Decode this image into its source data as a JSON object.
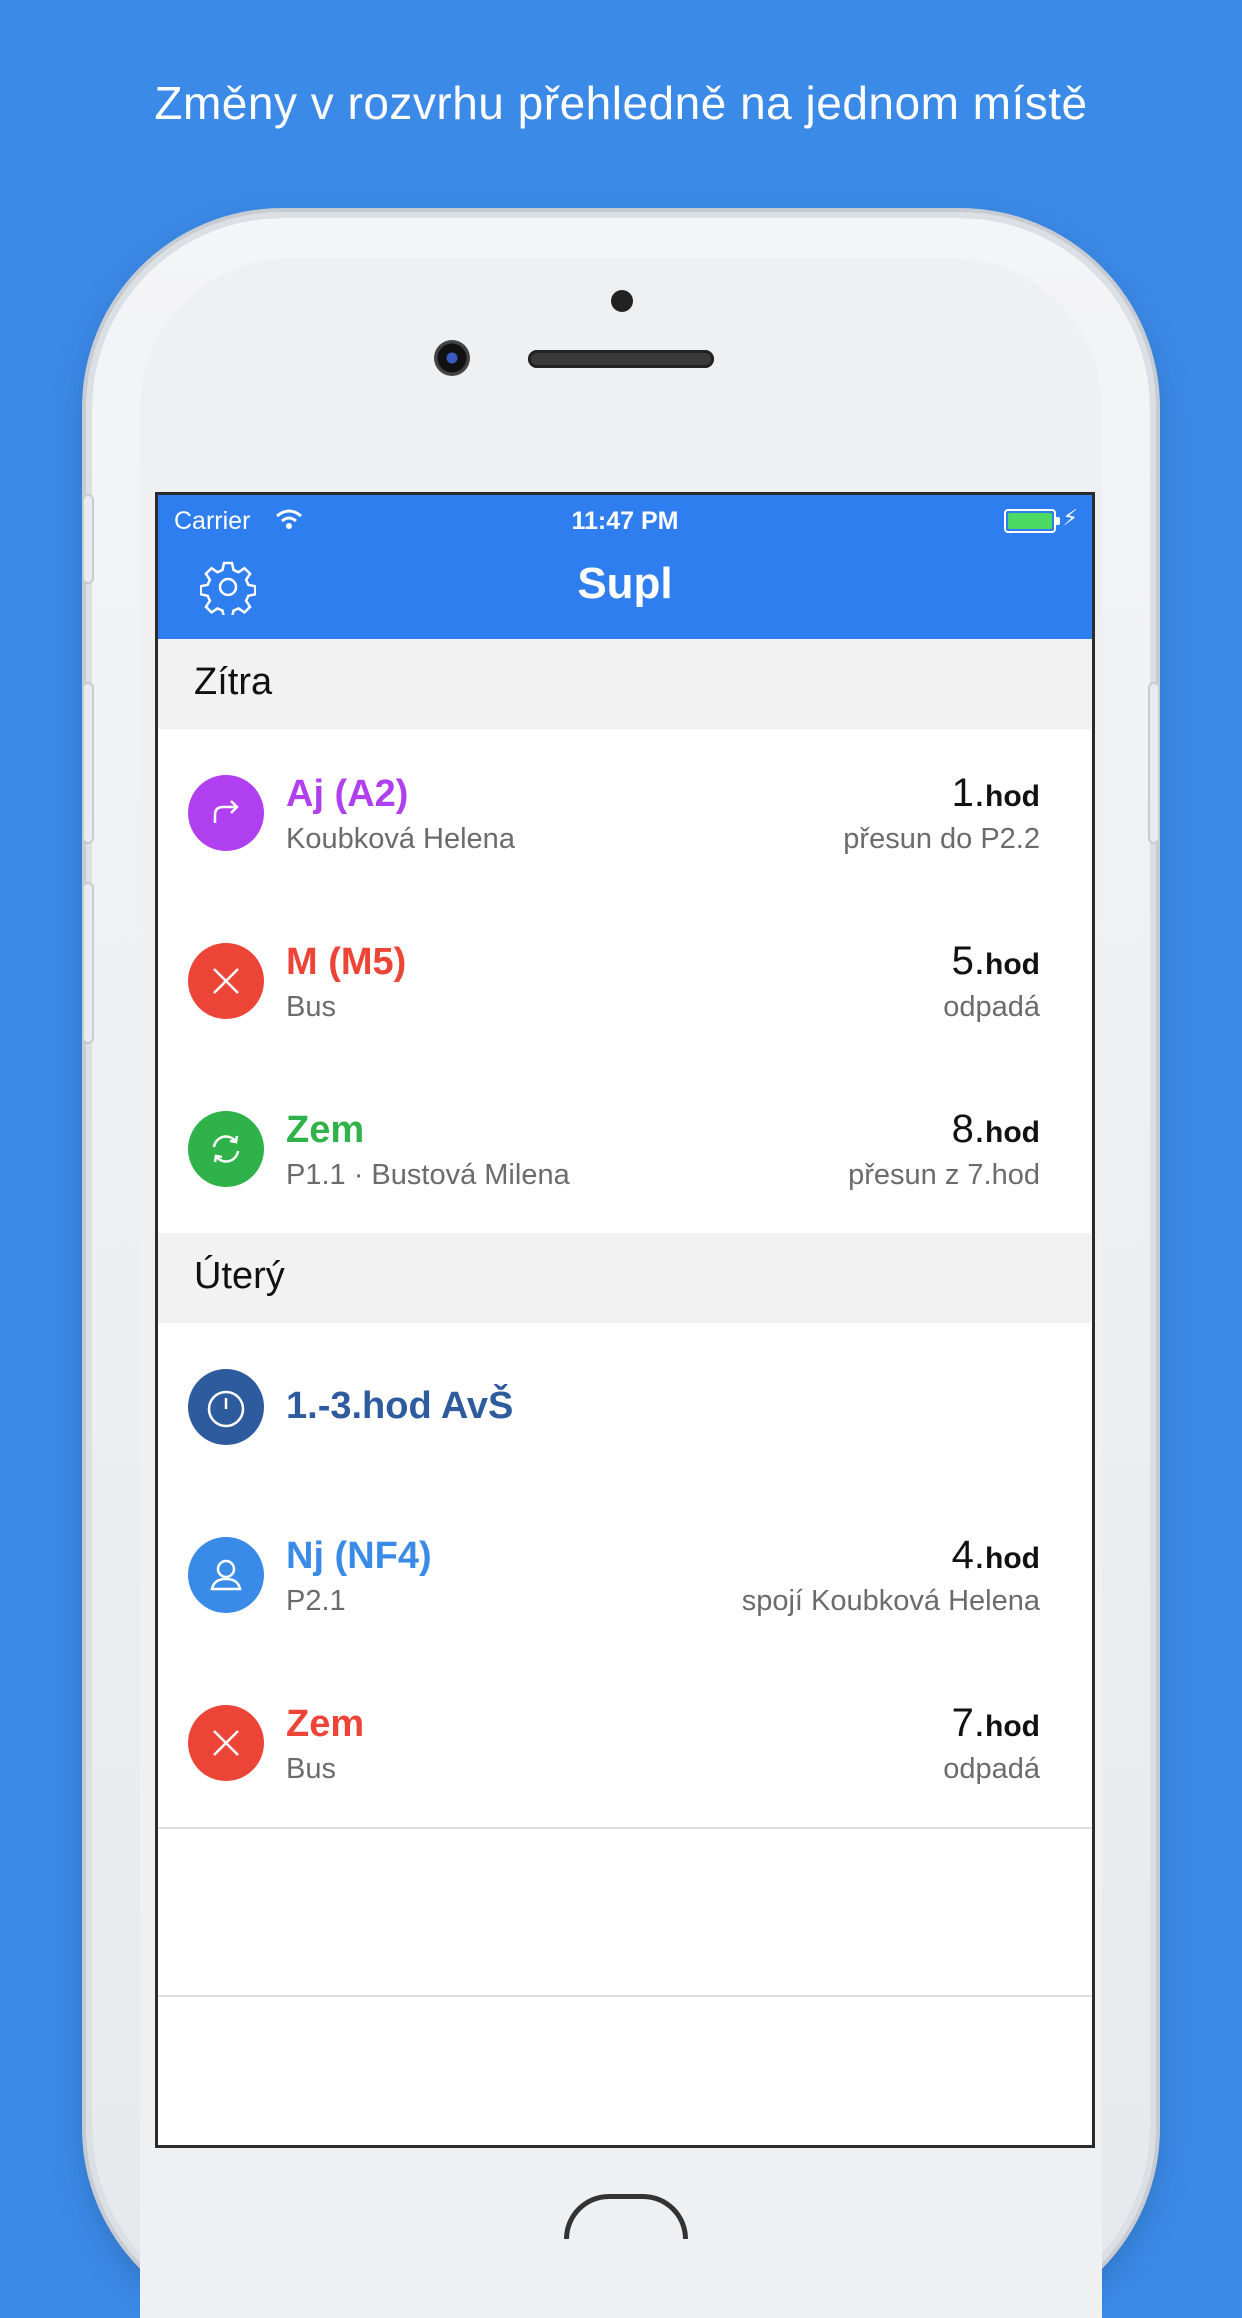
{
  "headline": "Změny v rozvrhu přehledně na jednom místě",
  "status": {
    "carrier": "Carrier",
    "time": "11:47 PM"
  },
  "nav": {
    "title": "Supl",
    "settings_icon": "gear-icon"
  },
  "colors": {
    "background": "#3b8ae8",
    "navbar": "#2f7ef0",
    "purple": "#b03ff0",
    "red": "#ec4436",
    "green": "#2fb24a",
    "navy": "#2e5a9e",
    "blue": "#3a8ae8"
  },
  "sections": [
    {
      "label": "Zítra",
      "rows": [
        {
          "icon": "forward-arrow-icon",
          "color": "#b03ff0",
          "title": "Aj (A2)",
          "subtitle": "Koubková Helena",
          "hour_num": "1.",
          "hour_unit": "hod",
          "note": "přesun do P2.2"
        },
        {
          "icon": "cross-icon",
          "color": "#ec4436",
          "title": "M (M5)",
          "subtitle": "Bus",
          "hour_num": "5.",
          "hour_unit": "hod",
          "note": "odpadá"
        },
        {
          "icon": "refresh-icon",
          "color": "#2fb24a",
          "title": "Zem",
          "subtitle": "P1.1 · Bustová Milena",
          "hour_num": "8.",
          "hour_unit": "hod",
          "note": "přesun z 7.hod"
        }
      ]
    },
    {
      "label": "Úterý",
      "rows": [
        {
          "icon": "timer-icon",
          "color": "#2e5a9e",
          "title": "1.-3.hod AvŠ"
        },
        {
          "icon": "person-icon",
          "color": "#3a8ae8",
          "title": "Nj (NF4)",
          "subtitle": "P2.1",
          "hour_num": "4.",
          "hour_unit": "hod",
          "note": "spojí Koubková Helena"
        },
        {
          "icon": "cross-icon",
          "color": "#ec4436",
          "title": "Zem",
          "subtitle": "Bus",
          "hour_num": "7.",
          "hour_unit": "hod",
          "note": "odpadá"
        }
      ]
    }
  ]
}
